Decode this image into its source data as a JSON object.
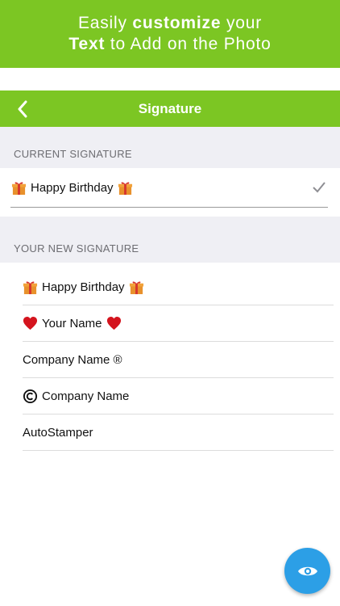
{
  "banner": {
    "line1_pre": "Easily ",
    "line1_bold": "customize",
    "line1_post": " your",
    "line2_bold": "Text",
    "line2_post": " to Add on the Photo"
  },
  "navbar": {
    "back_icon": "chevron-left-icon",
    "title": "Signature"
  },
  "current_section": {
    "header": "CURRENT SIGNATURE",
    "value": "Happy Birthday",
    "value_prefix_icon": "gift-icon",
    "value_suffix_icon": "gift-icon",
    "status_icon": "checkmark-icon"
  },
  "new_section": {
    "header": "YOUR NEW SIGNATURE",
    "items": [
      {
        "text": "Happy Birthday",
        "prefix_icon": "gift-icon",
        "suffix_icon": "gift-icon"
      },
      {
        "text": "Your Name",
        "prefix_icon": "heart-icon",
        "suffix_icon": "heart-icon"
      },
      {
        "text": "Company Name ®"
      },
      {
        "text": "Company Name",
        "prefix_icon": "copyright-icon"
      },
      {
        "text": "AutoStamper"
      }
    ]
  },
  "fab": {
    "icon": "eye-icon"
  },
  "colors": {
    "brand_green": "#7cc623",
    "section_bg": "#efeff4",
    "fab_blue": "#2c9fe6"
  }
}
